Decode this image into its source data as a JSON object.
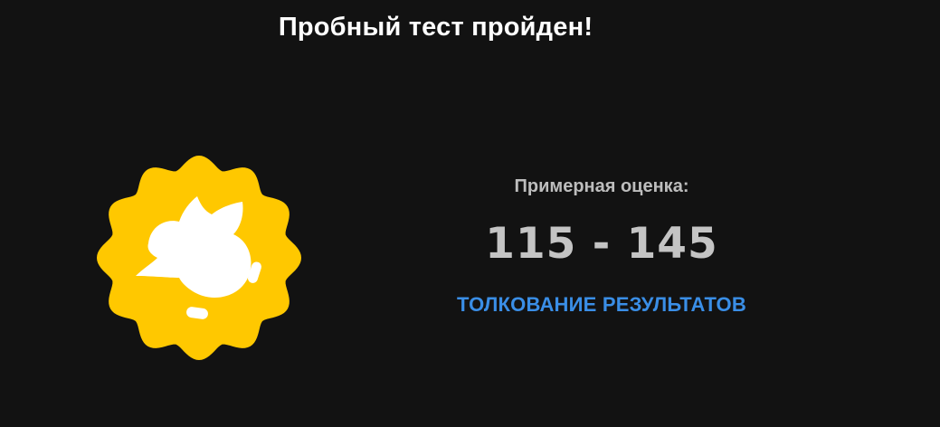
{
  "header": {
    "title": "Пробный тест пройден!"
  },
  "badge": {
    "icon": "owl-badge-icon",
    "color": "#ffc800"
  },
  "result": {
    "label": "Примерная оценка:",
    "score_range": "115 - 145",
    "interpret_link": "ТОЛКОВАНИЕ РЕЗУЛЬТАТОВ"
  },
  "colors": {
    "background": "#121212",
    "link": "#3a8ee6",
    "badge": "#ffc800"
  }
}
